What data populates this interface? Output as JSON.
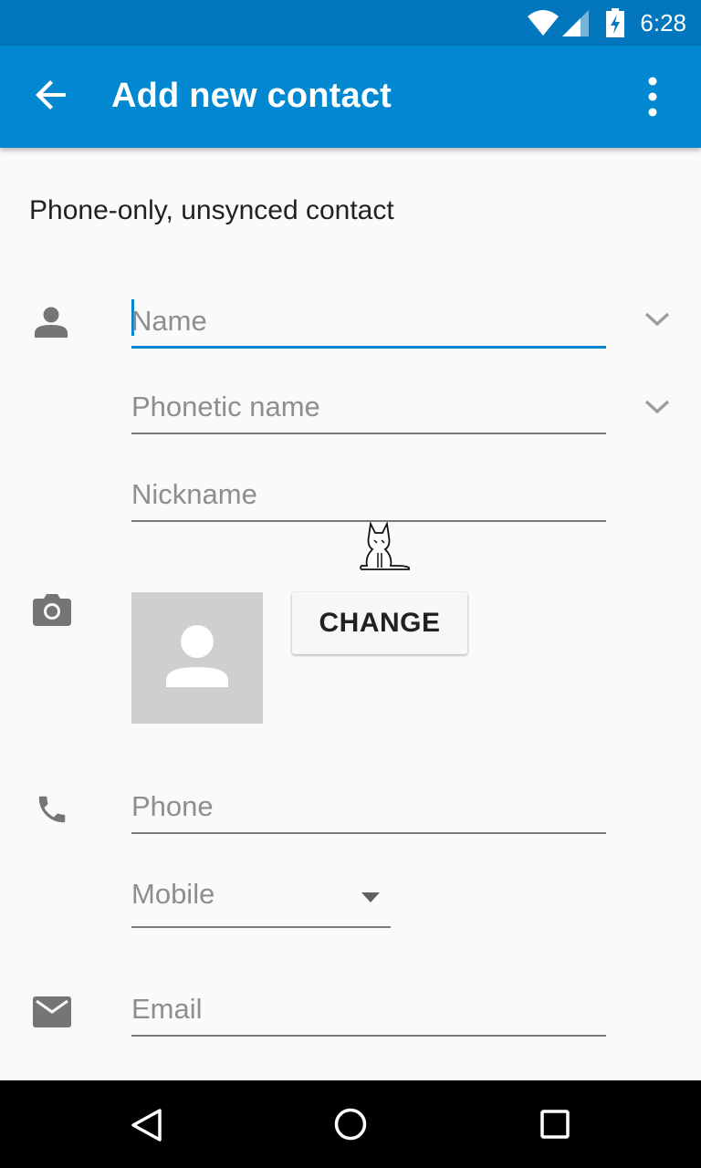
{
  "status_bar": {
    "time": "6:28",
    "icons": [
      "wifi-icon",
      "cell-signal-icon",
      "battery-charging-icon"
    ]
  },
  "app_bar": {
    "title": "Add new contact",
    "icons": [
      "back-arrow-icon",
      "more-vert-icon"
    ]
  },
  "account_label": "Phone-only, unsynced contact",
  "name_section": {
    "icon": "person-icon",
    "name_placeholder": "Name",
    "phonetic_placeholder": "Phonetic name",
    "nickname_placeholder": "Nickname"
  },
  "photo_section": {
    "icon": "camera-icon",
    "change_label": "CHANGE"
  },
  "phone_section": {
    "icon": "phone-icon",
    "phone_placeholder": "Phone",
    "type_value": "Mobile"
  },
  "email_section": {
    "icon": "email-icon",
    "email_placeholder": "Email"
  },
  "nav_bar": {
    "icons": [
      "back-triangle-icon",
      "home-circle-icon",
      "recents-square-icon"
    ]
  },
  "colors": {
    "status_bar": "#0277bd",
    "app_bar": "#0288d1",
    "accent": "#0288d1",
    "background": "#fafafa"
  }
}
